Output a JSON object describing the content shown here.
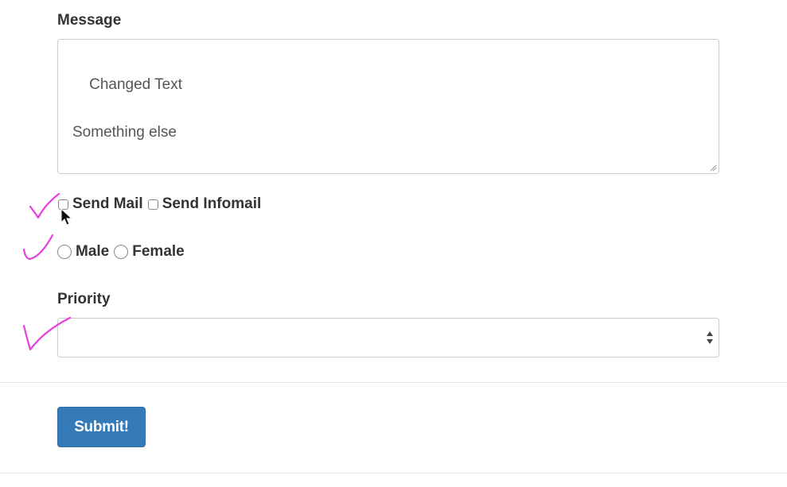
{
  "form": {
    "message_label": "Message",
    "message_value": "Changed Text\n\nSomething else",
    "checkboxes": [
      {
        "label": "Send Mail",
        "checked": false
      },
      {
        "label": "Send Infomail",
        "checked": false
      }
    ],
    "radios": [
      {
        "label": "Male",
        "selected": false
      },
      {
        "label": "Female",
        "selected": false
      }
    ],
    "priority_label": "Priority",
    "priority_value": "",
    "submit_label": "Submit!"
  },
  "annotations": {
    "checkmark_color": "#e83ce0",
    "checkmark_count": 3
  },
  "colors": {
    "primary_button": "#337ab7",
    "border": "#cccccc",
    "text": "#333333"
  }
}
